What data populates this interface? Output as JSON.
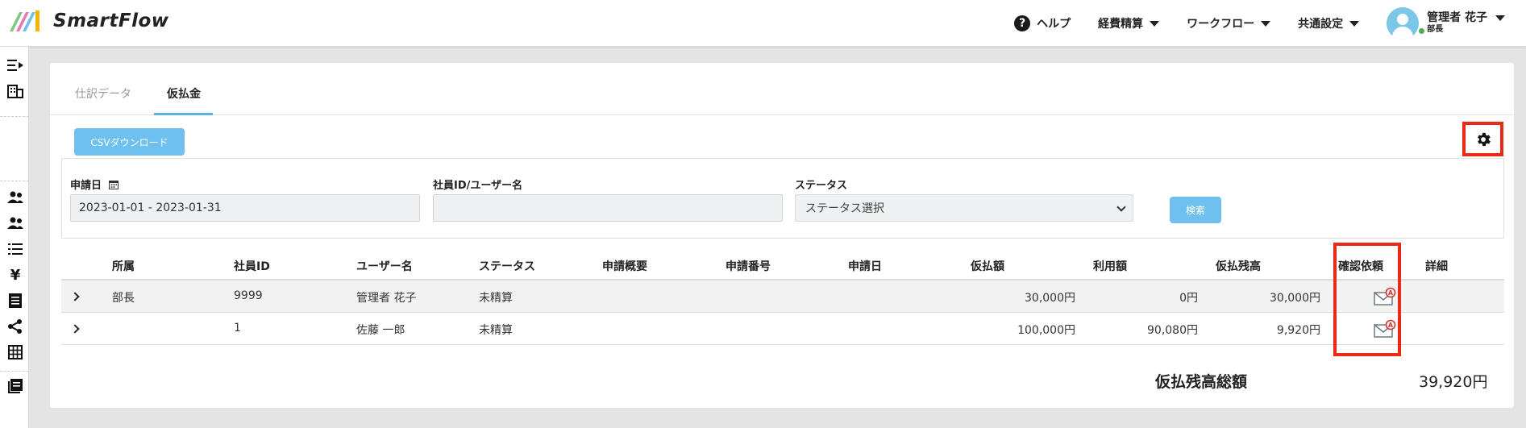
{
  "app": {
    "name": "SmartFlow"
  },
  "header": {
    "help_label": "ヘルプ",
    "menus": [
      "経費精算",
      "ワークフロー",
      "共通設定"
    ],
    "user_name": "管理者 花子",
    "user_role": "部長"
  },
  "tabs": [
    {
      "label": "仕訳データ",
      "active": false
    },
    {
      "label": "仮払金",
      "active": true
    }
  ],
  "toolbar": {
    "csv_label": "CSVダウンロード"
  },
  "filters": {
    "date_label": "申請日",
    "date_value": "2023-01-01 - 2023-01-31",
    "user_label": "社員ID/ユーザー名",
    "user_value": "",
    "status_label": "ステータス",
    "status_value": "ステータス選択",
    "search_label": "検索"
  },
  "table": {
    "columns": [
      "所属",
      "社員ID",
      "ユーザー名",
      "ステータス",
      "申請概要",
      "申請番号",
      "申請日",
      "仮払額",
      "利用額",
      "仮払残高",
      "確認依頼",
      "詳細"
    ],
    "rows": [
      {
        "dept": "部長",
        "id": "9999",
        "name": "管理者 花子",
        "status": "未精算",
        "summary": "",
        "number": "",
        "date": "",
        "advance": "30,000円",
        "used": "0円",
        "balance": "30,000円"
      },
      {
        "dept": "",
        "id": "1",
        "name": "佐藤 一郎",
        "status": "未精算",
        "summary": "",
        "number": "",
        "date": "",
        "advance": "100,000円",
        "used": "90,080円",
        "balance": "9,920円"
      }
    ]
  },
  "total": {
    "label": "仮払残高総額",
    "value": "39,920円"
  },
  "colors": {
    "accent": "#6ec1ee",
    "highlight": "#ea2a16",
    "online": "#4caf50"
  }
}
